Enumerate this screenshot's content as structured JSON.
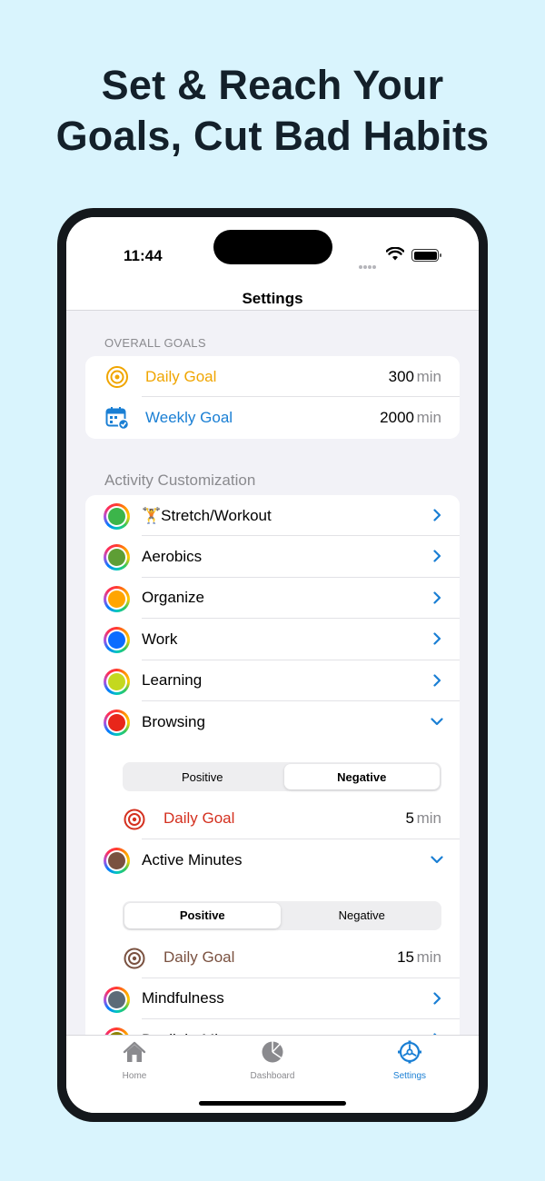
{
  "headline": {
    "line1": "Set & Reach Your",
    "line2": "Goals, Cut Bad Habits"
  },
  "status_bar": {
    "time": "11:44"
  },
  "nav": {
    "title": "Settings"
  },
  "overall_goals": {
    "header": "OVERALL GOALS",
    "items": [
      {
        "label": "Daily Goal",
        "value": "300",
        "unit": "min",
        "color": "#f0a500",
        "icon": "target-icon"
      },
      {
        "label": "Weekly Goal",
        "value": "2000",
        "unit": "min",
        "color": "#1a7fd4",
        "icon": "calendar-icon"
      }
    ]
  },
  "activity": {
    "header": "Activity Customization",
    "items": [
      {
        "label": "🏋️Stretch/Workout",
        "color": "#3cb54a"
      },
      {
        "label": "Aerobics",
        "color": "#5e9e35"
      },
      {
        "label": "Organize",
        "color": "#ffa500"
      },
      {
        "label": "Work",
        "color": "#0a6cff"
      },
      {
        "label": "Learning",
        "color": "#c4d81f"
      },
      {
        "label": "Browsing",
        "color": "#e8261a",
        "expanded": true,
        "segment": {
          "options": [
            "Positive",
            "Negative"
          ],
          "selected": "Negative"
        },
        "goal": {
          "label": "Daily Goal",
          "value": "5",
          "unit": "min",
          "color": "#d4301f"
        }
      },
      {
        "label": "Active Minutes",
        "color": "#7a5140",
        "expanded": true,
        "segment": {
          "options": [
            "Positive",
            "Negative"
          ],
          "selected": "Positive"
        },
        "goal": {
          "label": "Daily Goal",
          "value": "15",
          "unit": "min",
          "color": "#7a5140"
        }
      },
      {
        "label": "Mindfulness",
        "color": "#5c6b78"
      },
      {
        "label": "Daylight Minutes",
        "color": "#8c8200"
      }
    ]
  },
  "tabs": [
    {
      "label": "Home",
      "icon": "house-icon",
      "active": false
    },
    {
      "label": "Dashboard",
      "icon": "pie-chart-icon",
      "active": false
    },
    {
      "label": "Settings",
      "icon": "gear-icon",
      "active": true
    }
  ],
  "accent": "#1a7fd4"
}
